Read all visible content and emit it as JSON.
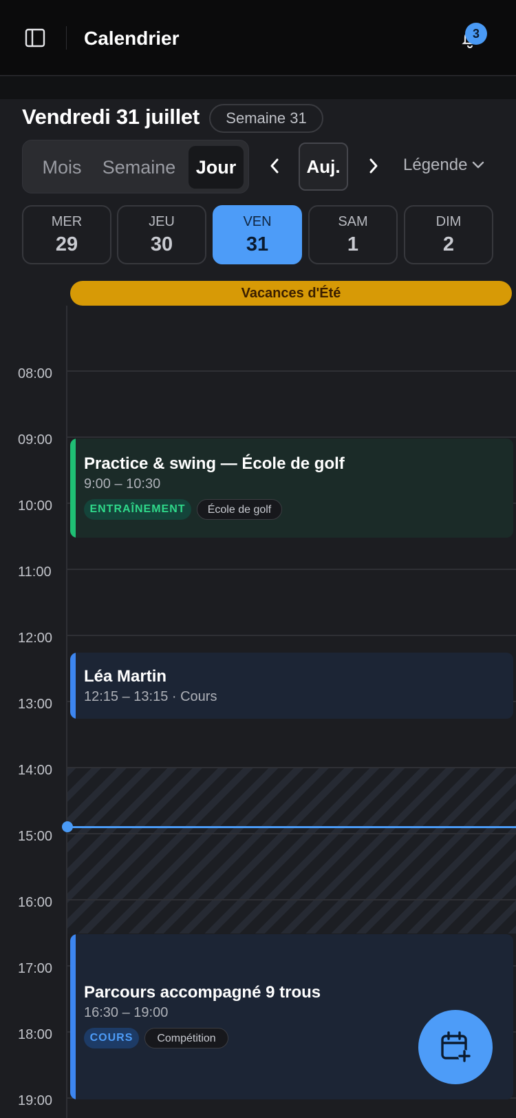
{
  "topbar": {
    "title": "Calendrier",
    "notifications_count": "3",
    "icons": [
      "sidebar-toggle-icon",
      "bell-icon"
    ]
  },
  "header": {
    "date_title": "Vendredi 31 juillet",
    "week_label": "Semaine 31",
    "views": [
      "Mois",
      "Semaine",
      "Jour"
    ],
    "active_view": "Jour",
    "today_label": "Auj.",
    "legend_label": "Légende"
  },
  "days": [
    {
      "name": "MER",
      "num": "29"
    },
    {
      "name": "JEU",
      "num": "30"
    },
    {
      "name": "VEN",
      "num": "31"
    },
    {
      "name": "SAM",
      "num": "1"
    },
    {
      "name": "DIM",
      "num": "2"
    }
  ],
  "holiday": "Vacances d'Été",
  "hours": [
    "08:00",
    "09:00",
    "10:00",
    "11:00",
    "12:00",
    "13:00",
    "14:00",
    "15:00",
    "16:00",
    "17:00",
    "18:00",
    "19:00"
  ],
  "events": [
    {
      "title": "Practice & swing — École de golf",
      "time": "9:00 – 10:30",
      "category": "ENTRAÎNEMENT",
      "tag": "École de golf"
    },
    {
      "title": "Léa Martin",
      "time": "12:15 – 13:15 · Cours"
    },
    {
      "title": "Parcours accompagné 9 trous",
      "time": "16:30 – 19:00",
      "category": "COURS",
      "tag": "Compétition"
    }
  ],
  "colors": {
    "accent": "#4d9cf8",
    "training": "#1fbf74",
    "lesson": "#3d86f0",
    "holiday": "#d79a06"
  }
}
